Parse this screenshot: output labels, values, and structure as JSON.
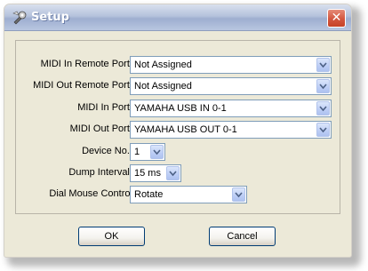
{
  "window": {
    "title": "Setup",
    "close_glyph": "✕",
    "icon": "setup-app-icon"
  },
  "fields": [
    {
      "label": "MIDI In Remote Port :",
      "value": "Not Assigned"
    },
    {
      "label": "MIDI Out Remote Port :",
      "value": "Not Assigned"
    },
    {
      "label": "MIDI In Port :",
      "value": "YAMAHA USB IN 0-1"
    },
    {
      "label": "MIDI Out Port :",
      "value": "YAMAHA USB OUT 0-1"
    },
    {
      "label": "Device No. :",
      "value": "1"
    },
    {
      "label": "Dump Interval :",
      "value": "15 ms"
    },
    {
      "label": "Dial Mouse Control:",
      "value": "Rotate"
    }
  ],
  "buttons": {
    "ok_label": "OK",
    "cancel_label": "Cancel"
  },
  "colors": {
    "title_bar": "#a9b8d8",
    "close_button": "#d3563f",
    "dialog_face": "#ece9d8",
    "field_border": "#7f9db9"
  }
}
